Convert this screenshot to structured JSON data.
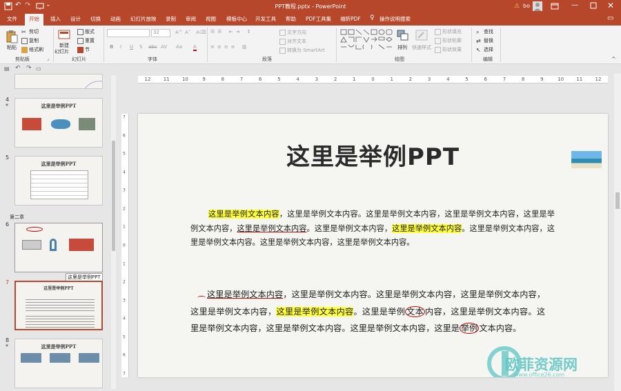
{
  "window": {
    "title": "PPT教程.pptx  -  PowerPoint",
    "user": "bo"
  },
  "quick_access": {
    "save": "save-icon",
    "undo": "undo-icon",
    "redo": "redo-icon",
    "present": "present-icon"
  },
  "ribbon_tabs": [
    "文件",
    "开始",
    "插入",
    "设计",
    "切换",
    "动画",
    "幻灯片放映",
    "录制",
    "审阅",
    "视图",
    "模板中心",
    "开发工具",
    "帮助",
    "PDF工具集",
    "福昕PDF"
  ],
  "active_tab": "开始",
  "tell_me": "操作说明搜索",
  "ribbon": {
    "clipboard": {
      "paste": "粘贴",
      "cut": "剪切",
      "copy": "复制",
      "format_painter": "格式刷",
      "label": "剪贴板"
    },
    "slides": {
      "new_slide": "新建",
      "new_slide2": "幻灯片",
      "layout": "版式",
      "reset": "重置",
      "section": "节",
      "label": "幻灯片"
    },
    "font": {
      "font_name": "",
      "font_size": "32",
      "bold": "B",
      "italic": "I",
      "underline": "U",
      "strike": "S",
      "shadow": "abc",
      "spacing": "AV",
      "case": "Aa",
      "label": "字体"
    },
    "paragraph": {
      "text_direction": "文字方向",
      "align_text": "对齐文本",
      "smartart": "转换为 SmartArt",
      "label": "段落"
    },
    "drawing": {
      "arrange": "排列",
      "quick_styles": "快速样式",
      "fill": "形状填充",
      "outline": "形状轮廓",
      "effects": "形状效果",
      "label": "绘图"
    },
    "editing": {
      "find": "查找",
      "replace": "替换",
      "select": "选择",
      "label": "编辑"
    }
  },
  "ruler": {
    "h_ticks": [
      "12",
      "11",
      "10",
      "9",
      "8",
      "7",
      "6",
      "5",
      "4",
      "3",
      "2",
      "1",
      "0",
      "1",
      "2",
      "3",
      "4",
      "5",
      "6",
      "7",
      "8",
      "9",
      "10",
      "11",
      "12"
    ],
    "v_ticks": [
      "7",
      "6",
      "5",
      "4",
      "3",
      "2",
      "1",
      "0",
      "1",
      "2",
      "3",
      "4",
      "5",
      "6",
      "7"
    ]
  },
  "slides_panel": {
    "items": [
      {
        "number": "4",
        "star": "*",
        "title": "这里是举例PPT"
      },
      {
        "number": "5",
        "star": "",
        "title": "这里是举例PPT"
      },
      {
        "number": "6",
        "star": "",
        "title": ""
      },
      {
        "number": "7",
        "star": "",
        "title": "这里是举例PPT"
      },
      {
        "number": "8",
        "star": "*",
        "title": "这里是举例PPT"
      }
    ],
    "section": "第二章",
    "tooltip": "这里是举例PPT"
  },
  "slide": {
    "title": "这里是举例PPT",
    "para1": [
      {
        "t": "这里是举例文本内容",
        "s": "hl"
      },
      {
        "t": "，这里是举例文本内容。这里是举例文本内容，这里是举例文本内容，这里是举例文本内容，",
        "s": ""
      },
      {
        "t": "这里是举例文本内容",
        "s": "ul"
      },
      {
        "t": "。这里是举例文本内容，",
        "s": ""
      },
      {
        "t": "这里是举例文本内容",
        "s": "hl"
      },
      {
        "t": "。这里是举例文本内容，这里是举例文本内容。这里是举例文本内容，这里是举例文本内容。",
        "s": ""
      }
    ],
    "para2": [
      {
        "t": "这里是举例文本内容",
        "s": "ul"
      },
      {
        "t": "，这里是举例文本内容。这里是举例文本内容，这里是举例文本内容，这里是举例文本内容，",
        "s": ""
      },
      {
        "t": "这里是举例文本内容",
        "s": "hl"
      },
      {
        "t": "。这里是举例",
        "s": ""
      },
      {
        "t": "文本",
        "s": "circ"
      },
      {
        "t": "内容，这里是举例文本内容。这里是举例文本内容，这里是举例文本内容。这里是举例文本内容，这里是",
        "s": ""
      },
      {
        "t": "举例",
        "s": "circ"
      },
      {
        "t": "文本内容。",
        "s": ""
      }
    ]
  },
  "watermark": {
    "brand": "欧菲资源网",
    "url": "www.office26.com"
  }
}
